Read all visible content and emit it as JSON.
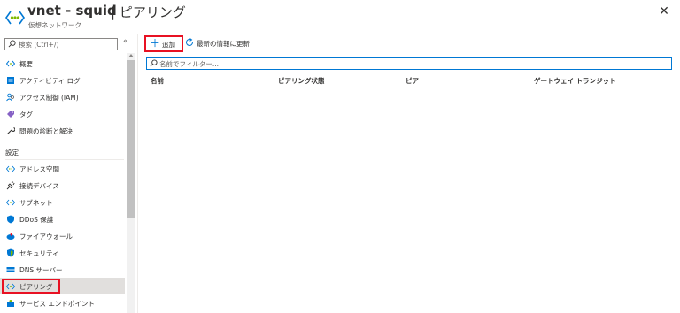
{
  "header": {
    "title": "vnet - squid",
    "separator_title": "| ピアリング",
    "subtitle": "仮想ネットワーク",
    "close_icon": "close-icon"
  },
  "sidebar": {
    "search_placeholder": "検索 (Ctrl+/)",
    "collapse_label": "«",
    "items_top": [
      {
        "label": "概要",
        "icon": "overview-icon",
        "color": "#0078d4"
      },
      {
        "label": "アクティビティ ログ",
        "icon": "activity-log-icon",
        "color": "#0078d4"
      },
      {
        "label": "アクセス制御 (IAM)",
        "icon": "iam-icon",
        "color": "#0078d4"
      },
      {
        "label": "タグ",
        "icon": "tag-icon",
        "color": "#8661c5"
      },
      {
        "label": "問題の診断と解決",
        "icon": "wrench-icon",
        "color": "#323130"
      }
    ],
    "section_label": "設定",
    "items_settings": [
      {
        "label": "アドレス空間",
        "icon": "address-space-icon",
        "color": "#0078d4"
      },
      {
        "label": "接続デバイス",
        "icon": "plug-icon",
        "color": "#323130"
      },
      {
        "label": "サブネット",
        "icon": "subnet-icon",
        "color": "#0078d4"
      },
      {
        "label": "DDoS 保護",
        "icon": "shield-icon",
        "color": "#0078d4"
      },
      {
        "label": "ファイアウォール",
        "icon": "firewall-icon",
        "color": "#e81123"
      },
      {
        "label": "セキュリティ",
        "icon": "security-shield-icon",
        "color": "#0078d4"
      },
      {
        "label": "DNS サーバー",
        "icon": "dns-icon",
        "color": "#0078d4"
      },
      {
        "label": "ピアリング",
        "icon": "peering-icon",
        "color": "#0078d4",
        "selected": true
      },
      {
        "label": "サービス エンドポイント",
        "icon": "service-endpoint-icon",
        "color": "#0078d4"
      }
    ]
  },
  "toolbar": {
    "add_label": "追加",
    "refresh_label": "最新の情報に更新"
  },
  "filter": {
    "placeholder": "名前でフィルター..."
  },
  "table": {
    "columns": [
      "名前",
      "ピアリング状態",
      "ピア",
      "ゲートウェイ トランジット"
    ]
  },
  "colors": {
    "accent": "#0078d4",
    "highlight_border": "#e81123",
    "selected_bg": "#e1dfdd"
  }
}
